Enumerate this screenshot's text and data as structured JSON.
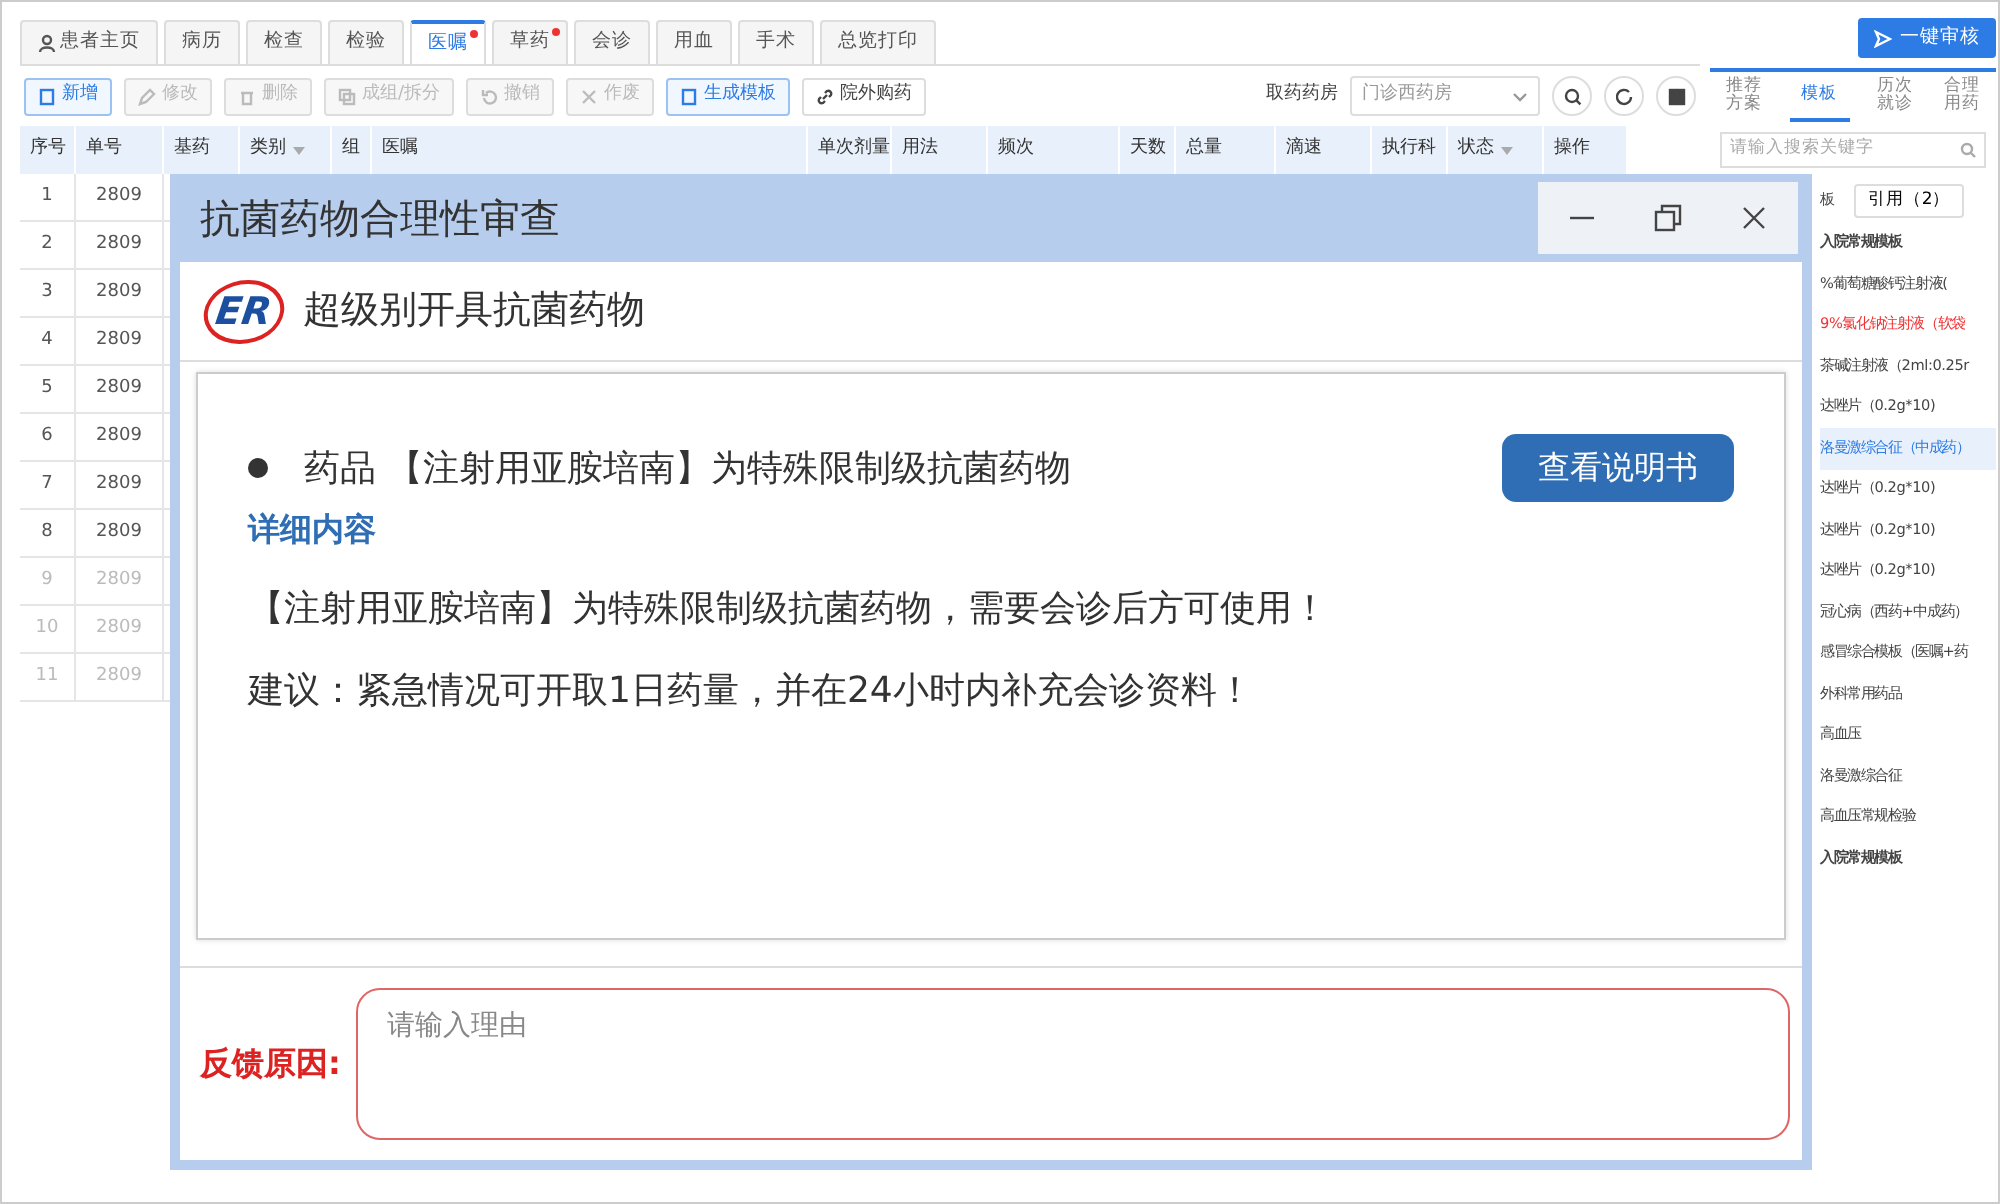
{
  "tabs": [
    {
      "label": "患者主页",
      "selected": false,
      "flagged": false
    },
    {
      "label": "病历",
      "selected": false,
      "flagged": false
    },
    {
      "label": "检查",
      "selected": false,
      "flagged": false
    },
    {
      "label": "检验",
      "selected": false,
      "flagged": false
    },
    {
      "label": "医嘱",
      "selected": true,
      "flagged": true
    },
    {
      "label": "草药",
      "selected": false,
      "flagged": true
    },
    {
      "label": "会诊",
      "selected": false,
      "flagged": false
    },
    {
      "label": "用血",
      "selected": false,
      "flagged": false
    },
    {
      "label": "手术",
      "selected": false,
      "flagged": false
    },
    {
      "label": "总览打印",
      "selected": false,
      "flagged": false
    }
  ],
  "review_button": "一键审核",
  "toolbar": [
    {
      "label": "新增",
      "disabled": false,
      "primary": true
    },
    {
      "label": "修改",
      "disabled": true,
      "primary": false
    },
    {
      "label": "删除",
      "disabled": true,
      "primary": false
    },
    {
      "label": "成组/拆分",
      "disabled": true,
      "primary": false
    },
    {
      "label": "撤销",
      "disabled": true,
      "primary": false
    },
    {
      "label": "作废",
      "disabled": true,
      "primary": false
    },
    {
      "label": "生成模板",
      "disabled": false,
      "primary": true
    },
    {
      "label": "院外购药",
      "disabled": false,
      "primary": false
    }
  ],
  "pharmacy": {
    "label": "取药药房",
    "value": "门诊西药房"
  },
  "table": {
    "columns": [
      {
        "label": "序号"
      },
      {
        "label": "单号"
      },
      {
        "label": "基药"
      },
      {
        "label": "类别",
        "filter": true
      },
      {
        "label": "组"
      },
      {
        "label": "医嘱"
      },
      {
        "label": "单次剂量"
      },
      {
        "label": "用法"
      },
      {
        "label": "频次"
      },
      {
        "label": "天数"
      },
      {
        "label": "总量"
      },
      {
        "label": "滴速"
      },
      {
        "label": "执行科"
      },
      {
        "label": "状态",
        "filter": true
      },
      {
        "label": "操作"
      }
    ],
    "rows": [
      {
        "index": "1",
        "order_no": "2809",
        "dimmed": false
      },
      {
        "index": "2",
        "order_no": "2809",
        "dimmed": false
      },
      {
        "index": "3",
        "order_no": "2809",
        "dimmed": false
      },
      {
        "index": "4",
        "order_no": "2809",
        "dimmed": false
      },
      {
        "index": "5",
        "order_no": "2809",
        "dimmed": false
      },
      {
        "index": "6",
        "order_no": "2809",
        "dimmed": false
      },
      {
        "index": "7",
        "order_no": "2809",
        "dimmed": false
      },
      {
        "index": "8",
        "order_no": "2809",
        "dimmed": false
      },
      {
        "index": "9",
        "order_no": "2809",
        "dimmed": true
      },
      {
        "index": "10",
        "order_no": "2809",
        "dimmed": true
      },
      {
        "index": "11",
        "order_no": "2809",
        "dimmed": true
      }
    ]
  },
  "side_panel": {
    "tabs": [
      {
        "label": "推荐方案",
        "selected": false
      },
      {
        "label": "模板",
        "selected": true
      },
      {
        "label": "历次就诊",
        "selected": false
      },
      {
        "label": "合理用药",
        "selected": false
      }
    ],
    "search": {
      "placeholder": "请输入搜索关键字"
    },
    "sub_tab": "板",
    "cite_button": "引用（2）",
    "items": [
      {
        "label": "入院常规模板",
        "kind": "group"
      },
      {
        "label": "%葡萄糖酸钙注射液(",
        "kind": "drug"
      },
      {
        "label": "9%氯化钠注射液（软袋",
        "kind": "warning"
      },
      {
        "label": "茶碱注射液（2ml:0.25r",
        "kind": "drug"
      },
      {
        "label": "达唑片（0.2g*10)",
        "kind": "drug"
      },
      {
        "label": "洛曼激综合征（中成药）",
        "kind": "active"
      },
      {
        "label": "达唑片（0.2g*10)",
        "kind": "drug"
      },
      {
        "label": "达唑片（0.2g*10)",
        "kind": "drug"
      },
      {
        "label": "达唑片（0.2g*10)",
        "kind": "drug"
      },
      {
        "label": "冠心病（西药+中成药）",
        "kind": "drug"
      },
      {
        "label": "感冒综合模板（医嘱+药",
        "kind": "drug"
      },
      {
        "label": "外科常用药品",
        "kind": "drug"
      },
      {
        "label": "高血压",
        "kind": "drug"
      },
      {
        "label": "洛曼激综合征",
        "kind": "drug"
      },
      {
        "label": "高血压常规检验",
        "kind": "drug"
      },
      {
        "label": "入院常规模板",
        "kind": "group"
      }
    ]
  },
  "dialog": {
    "title": "抗菌药物合理性审查",
    "logo_text": "ER",
    "heading": "超级别开具抗菌药物",
    "message": "药品 【注射用亚胺培南】为特殊限制级抗菌药物",
    "manual_button": "查看说明书",
    "details_label": "详细内容",
    "details": [
      "【注射用亚胺培南】为特殊限制级抗菌药物，需要会诊后方可使用！",
      "建议：紧急情况可开取1日药量，并在24小时内补充会诊资料！"
    ],
    "feedback": {
      "label": "反馈原因:",
      "placeholder": "请输入理由"
    }
  }
}
